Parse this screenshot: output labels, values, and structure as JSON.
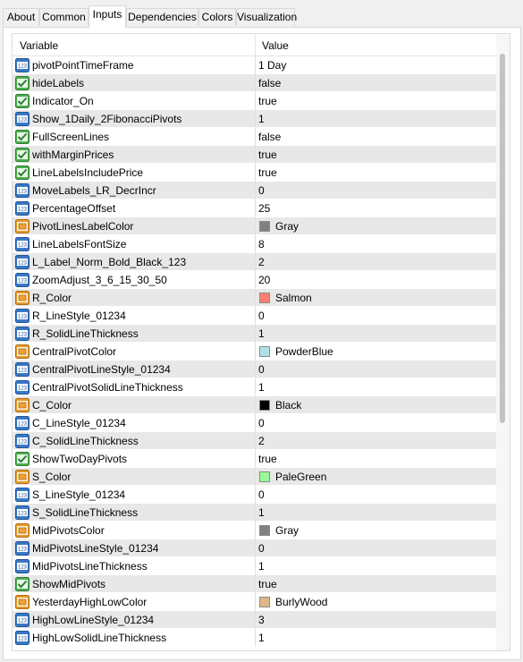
{
  "tabs": [
    {
      "label": "About"
    },
    {
      "label": "Common"
    },
    {
      "label": "Inputs"
    },
    {
      "label": "Dependencies"
    },
    {
      "label": "Colors"
    },
    {
      "label": "Visualization"
    }
  ],
  "grid": {
    "header": {
      "variable": "Variable",
      "value": "Value"
    },
    "rows": [
      {
        "icon": "numeric-icon",
        "name": "pivotPointTimeFrame",
        "value": "1 Day"
      },
      {
        "icon": "bool-icon",
        "name": "hideLabels",
        "value": "false"
      },
      {
        "icon": "bool-icon",
        "name": "Indicator_On",
        "value": "true"
      },
      {
        "icon": "numeric-icon",
        "name": "Show_1Daily_2FibonacciPivots",
        "value": "1"
      },
      {
        "icon": "bool-icon",
        "name": "FullScreenLines",
        "value": "false"
      },
      {
        "icon": "bool-icon",
        "name": "withMarginPrices",
        "value": "true"
      },
      {
        "icon": "bool-icon",
        "name": "LineLabelsIncludePrice",
        "value": "true"
      },
      {
        "icon": "numeric-icon",
        "name": "MoveLabels_LR_DecrIncr",
        "value": "0"
      },
      {
        "icon": "numeric-icon",
        "name": "PercentageOffset",
        "value": "25"
      },
      {
        "icon": "color-icon",
        "name": "PivotLinesLabelColor",
        "value": "Gray",
        "swatch": "#808080"
      },
      {
        "icon": "numeric-icon",
        "name": "LineLabelsFontSize",
        "value": "8"
      },
      {
        "icon": "numeric-icon",
        "name": "L_Label_Norm_Bold_Black_123",
        "value": "2"
      },
      {
        "icon": "numeric-icon",
        "name": "ZoomAdjust_3_6_15_30_50",
        "value": "20"
      },
      {
        "icon": "color-icon",
        "name": "R_Color",
        "value": "Salmon",
        "swatch": "#fa8072"
      },
      {
        "icon": "numeric-icon",
        "name": "R_LineStyle_01234",
        "value": "0"
      },
      {
        "icon": "numeric-icon",
        "name": "R_SolidLineThickness",
        "value": "1"
      },
      {
        "icon": "color-icon",
        "name": "CentralPivotColor",
        "value": "PowderBlue",
        "swatch": "#b0e0e6"
      },
      {
        "icon": "numeric-icon",
        "name": "CentralPivotLineStyle_01234",
        "value": "0"
      },
      {
        "icon": "numeric-icon",
        "name": "CentralPivotSolidLineThickness",
        "value": "1"
      },
      {
        "icon": "color-icon",
        "name": "C_Color",
        "value": "Black",
        "swatch": "#000000"
      },
      {
        "icon": "numeric-icon",
        "name": "C_LineStyle_01234",
        "value": "0"
      },
      {
        "icon": "numeric-icon",
        "name": "C_SolidLineThickness",
        "value": "2"
      },
      {
        "icon": "bool-icon",
        "name": "ShowTwoDayPivots",
        "value": "true"
      },
      {
        "icon": "color-icon",
        "name": "S_Color",
        "value": "PaleGreen",
        "swatch": "#98fb98"
      },
      {
        "icon": "numeric-icon",
        "name": "S_LineStyle_01234",
        "value": "0"
      },
      {
        "icon": "numeric-icon",
        "name": "S_SolidLineThickness",
        "value": "1"
      },
      {
        "icon": "color-icon",
        "name": "MidPivotsColor",
        "value": "Gray",
        "swatch": "#808080"
      },
      {
        "icon": "numeric-icon",
        "name": "MidPivotsLineStyle_01234",
        "value": "0"
      },
      {
        "icon": "numeric-icon",
        "name": "MidPivotsLineThickness",
        "value": "1"
      },
      {
        "icon": "bool-icon",
        "name": "ShowMidPivots",
        "value": "true"
      },
      {
        "icon": "color-icon",
        "name": "YesterdayHighLowColor",
        "value": "BurlyWood",
        "swatch": "#deb887"
      },
      {
        "icon": "numeric-icon",
        "name": "HighLowLineStyle_01234",
        "value": "3"
      },
      {
        "icon": "numeric-icon",
        "name": "HighLowSolidLineThickness",
        "value": "1"
      }
    ]
  }
}
